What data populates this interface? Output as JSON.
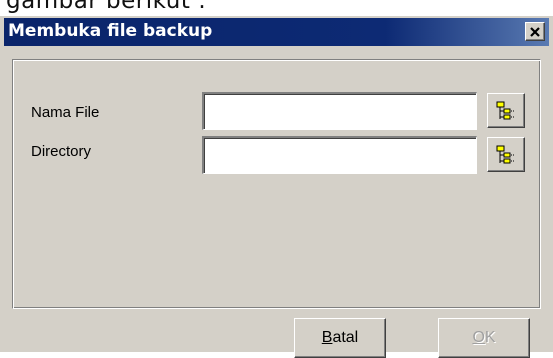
{
  "background_text": "gambar berikut :",
  "window": {
    "title": "Membuka file backup",
    "close_glyph": "×"
  },
  "form": {
    "nama_file_label": "Nama File",
    "nama_file_value": "",
    "directory_label": "Directory",
    "directory_value": "",
    "browse_icon": "folder-tree-icon"
  },
  "buttons": {
    "batal_first": "B",
    "batal_rest": "atal",
    "ok_first": "O",
    "ok_rest": "K"
  },
  "colors": {
    "titlebar": "#0a246a",
    "dialog_face": "#d4d0c8",
    "disabled_text": "#a0a0a0"
  }
}
